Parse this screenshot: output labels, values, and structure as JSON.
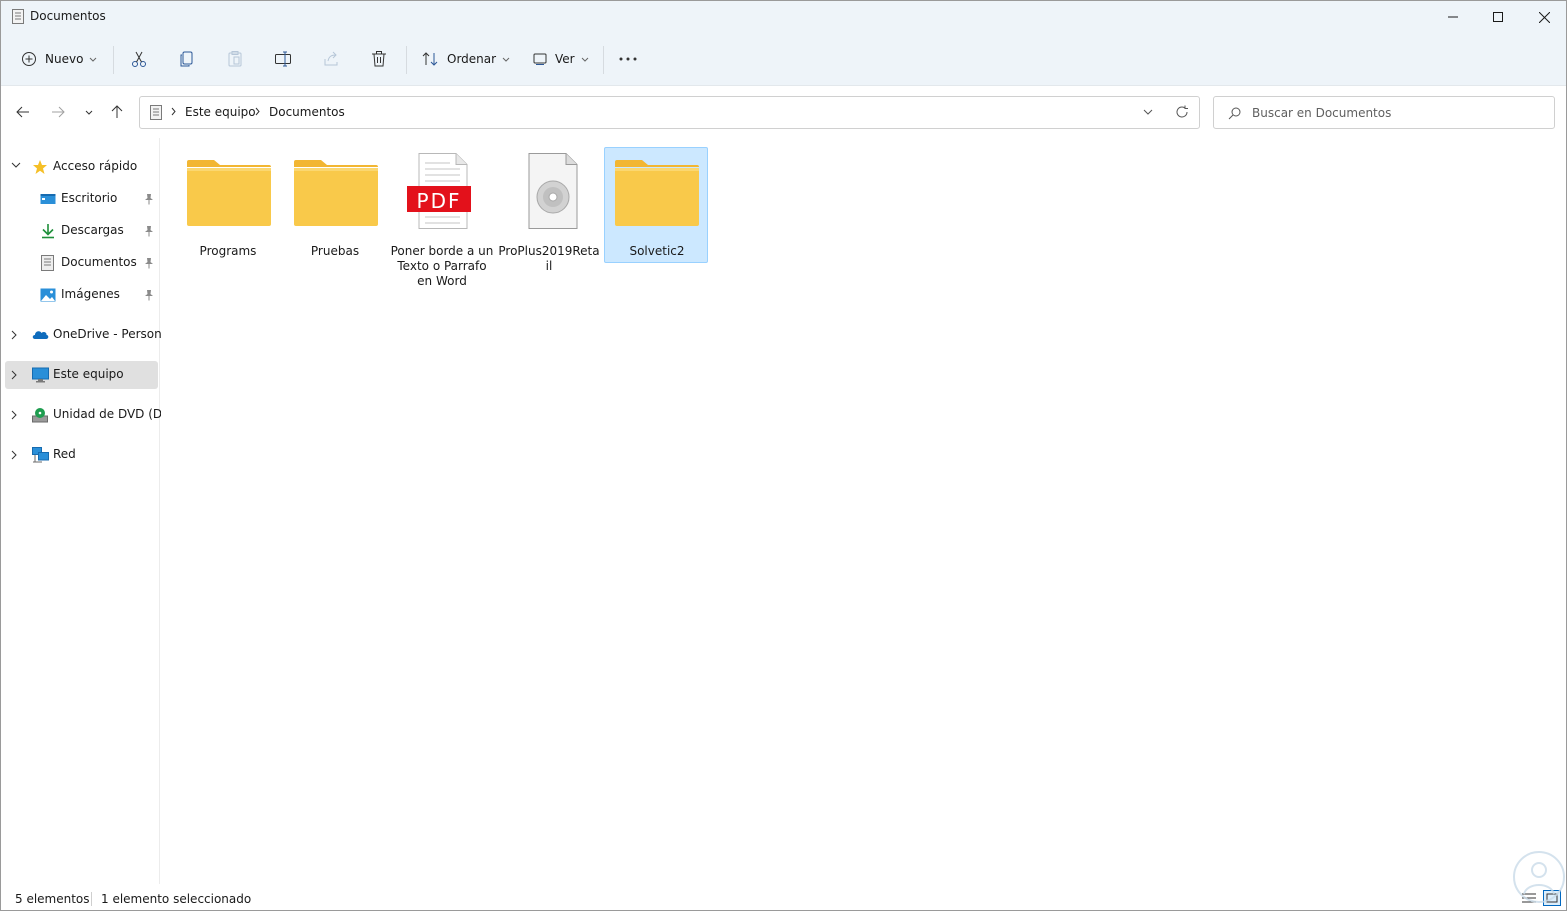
{
  "window": {
    "title": "Documentos"
  },
  "toolbar": {
    "new_label": "Nuevo",
    "sort_label": "Ordenar",
    "view_label": "Ver"
  },
  "address": {
    "crumbs": [
      "Este equipo",
      "Documentos"
    ],
    "search_placeholder": "Buscar en Documentos"
  },
  "sidebar": {
    "items": [
      {
        "label": "Acceso rápido",
        "icon": "star-icon"
      },
      {
        "label": "Escritorio",
        "icon": "desktop-icon",
        "pinned": true
      },
      {
        "label": "Descargas",
        "icon": "download-icon",
        "pinned": true
      },
      {
        "label": "Documentos",
        "icon": "document-icon",
        "pinned": true
      },
      {
        "label": "Imágenes",
        "icon": "image-icon",
        "pinned": true
      },
      {
        "label": "OneDrive - Personal",
        "icon": "cloud-icon"
      },
      {
        "label": "Este equipo",
        "icon": "computer-icon",
        "selected": true
      },
      {
        "label": "Unidad de DVD (D:)",
        "icon": "dvd-drive-icon"
      },
      {
        "label": "Red",
        "icon": "network-icon"
      }
    ]
  },
  "files": [
    {
      "name": "Programs",
      "type": "folder"
    },
    {
      "name": "Pruebas",
      "type": "folder"
    },
    {
      "name": "Poner borde a un Texto o Parrafo en Word",
      "type": "pdf",
      "badge": "PDF"
    },
    {
      "name": "ProPlus2019Retail",
      "type": "disc-image"
    },
    {
      "name": "Solvetic2",
      "type": "folder",
      "selected": true
    }
  ],
  "status": {
    "count": "5 elementos",
    "selection": "1 elemento seleccionado"
  },
  "colors": {
    "folder": "#f9c94a",
    "folder_back": "#f2b632",
    "selection_bg": "#cce8ff",
    "pdf_red": "#e3111b",
    "accent": "#0067c0"
  }
}
